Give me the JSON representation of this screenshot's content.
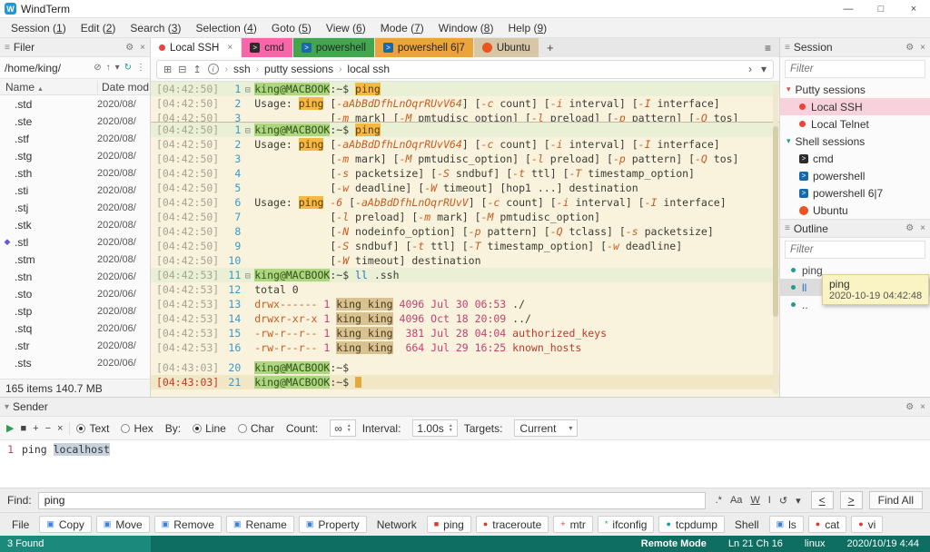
{
  "window": {
    "title": "WindTerm",
    "controls": [
      {
        "name": "minimize-button",
        "glyph": "—"
      },
      {
        "name": "maximize-button",
        "glyph": "□"
      },
      {
        "name": "close-button",
        "glyph": "×"
      }
    ]
  },
  "menu": {
    "items": [
      "Session (1)",
      "Edit (2)",
      "Search (3)",
      "Selection (4)",
      "Goto (5)",
      "View (6)",
      "Mode (7)",
      "Window (8)",
      "Help (9)"
    ]
  },
  "filer": {
    "title": "Filer",
    "path": "/home/king/",
    "path_icons": [
      {
        "name": "filter-off-icon",
        "glyph": "⊘"
      },
      {
        "name": "up-directory-icon",
        "glyph": "↑"
      },
      {
        "name": "history-icon",
        "glyph": "▾"
      },
      {
        "name": "refresh-icon",
        "glyph": "↻",
        "teal": true
      },
      {
        "name": "more-icon",
        "glyph": "⋮"
      }
    ],
    "columns": {
      "name": "Name",
      "date": "Date mod"
    },
    "rows": [
      {
        "name": ".std",
        "date": "2020/08/"
      },
      {
        "name": ".ste",
        "date": "2020/08/"
      },
      {
        "name": ".stf",
        "date": "2020/08/"
      },
      {
        "name": ".stg",
        "date": "2020/08/"
      },
      {
        "name": ".sth",
        "date": "2020/08/"
      },
      {
        "name": ".sti",
        "date": "2020/08/"
      },
      {
        "name": ".stj",
        "date": "2020/08/"
      },
      {
        "name": ".stk",
        "date": "2020/08/"
      },
      {
        "name": ".stl",
        "date": "2020/08/",
        "icon": "gem"
      },
      {
        "name": ".stm",
        "date": "2020/08/"
      },
      {
        "name": ".stn",
        "date": "2020/06/"
      },
      {
        "name": ".sto",
        "date": "2020/06/"
      },
      {
        "name": ".stp",
        "date": "2020/08/"
      },
      {
        "name": ".stq",
        "date": "2020/06/"
      },
      {
        "name": ".str",
        "date": "2020/08/"
      },
      {
        "name": ".sts",
        "date": "2020/06/"
      }
    ],
    "status": "165 items 140.7 MB"
  },
  "tabs": {
    "add_label": "+",
    "menu_icon": "≡",
    "items": [
      {
        "label": "Local SSH",
        "active": true,
        "color": "#ffffff"
      },
      {
        "label": "cmd",
        "icon": "cmd",
        "color": "#f666a8",
        "icon_color": "#2b2b2b"
      },
      {
        "label": "powershell",
        "icon": "ps",
        "color": "#42a64e",
        "icon_color": "#1769aa"
      },
      {
        "label": "powershell 6|7",
        "icon": "ps",
        "color": "#eaa43a",
        "icon_color": "#1769aa"
      },
      {
        "label": "Ubuntu",
        "icon": "ubuntu",
        "color": "#d6c7a6",
        "icon_color": "#e95420"
      }
    ]
  },
  "termbar": {
    "icons": [
      {
        "name": "new-terminal-icon",
        "glyph": "⊞"
      },
      {
        "name": "split-terminal-icon",
        "glyph": "⊟"
      },
      {
        "name": "detach-terminal-icon",
        "glyph": "↥"
      },
      {
        "name": "info-icon",
        "glyph": "i",
        "circle": true
      }
    ],
    "breadcrumb": [
      "ssh",
      "putty sessions",
      "local ssh"
    ],
    "end_icons": [
      {
        "name": "scroll-right-icon",
        "glyph": "›"
      },
      {
        "name": "sessions-dropdown-icon",
        "glyph": "▾"
      }
    ]
  },
  "terminal": {
    "top": [
      {
        "ts": "[04:42:50]",
        "num": "1",
        "fold": true,
        "bg": "cmdrow",
        "seg": [
          [
            "host",
            "king@MACBOOK"
          ],
          [
            "t",
            ":~$ "
          ],
          [
            "m",
            "ping"
          ]
        ]
      },
      {
        "ts": "[04:42:50]",
        "num": "2",
        "seg": [
          [
            "t",
            "Usage: "
          ],
          [
            "m",
            "ping"
          ],
          [
            "t",
            " ["
          ],
          [
            "f",
            "-aAbBdDfhLnOqrRUvV64"
          ],
          [
            "t",
            "] ["
          ],
          [
            "f",
            "-c"
          ],
          [
            "t",
            " count] ["
          ],
          [
            "f",
            "-i"
          ],
          [
            "t",
            " interval] ["
          ],
          [
            "f",
            "-I"
          ],
          [
            "t",
            " interface]"
          ]
        ]
      },
      {
        "ts": "[04:42:50]",
        "num": "3",
        "seg": [
          [
            "t",
            "            ["
          ],
          [
            "f",
            "-m"
          ],
          [
            "t",
            " mark] ["
          ],
          [
            "f",
            "-M"
          ],
          [
            "t",
            " pmtudisc_option] ["
          ],
          [
            "f",
            "-l"
          ],
          [
            "t",
            " preload] ["
          ],
          [
            "f",
            "-p"
          ],
          [
            "t",
            " pattern] ["
          ],
          [
            "f",
            "-Q"
          ],
          [
            "t",
            " tos]"
          ]
        ]
      }
    ],
    "lines": [
      {
        "ts": "[04:42:50]",
        "num": "1",
        "fold": true,
        "bg": "cmdrow",
        "seg": [
          [
            "host",
            "king@MACBOOK"
          ],
          [
            "t",
            ":~$ "
          ],
          [
            "m",
            "ping"
          ]
        ]
      },
      {
        "ts": "[04:42:50]",
        "num": "2",
        "seg": [
          [
            "t",
            "Usage: "
          ],
          [
            "m",
            "ping"
          ],
          [
            "t",
            " ["
          ],
          [
            "f",
            "-aAbBdDfhLnOqrRUvV64"
          ],
          [
            "t",
            "] ["
          ],
          [
            "f",
            "-c"
          ],
          [
            "t",
            " count] ["
          ],
          [
            "f",
            "-i"
          ],
          [
            "t",
            " interval] ["
          ],
          [
            "f",
            "-I"
          ],
          [
            "t",
            " interface]"
          ]
        ]
      },
      {
        "ts": "[04:42:50]",
        "num": "3",
        "seg": [
          [
            "t",
            "            ["
          ],
          [
            "f",
            "-m"
          ],
          [
            "t",
            " mark] ["
          ],
          [
            "f",
            "-M"
          ],
          [
            "t",
            " pmtudisc_option] ["
          ],
          [
            "f",
            "-l"
          ],
          [
            "t",
            " preload] ["
          ],
          [
            "f",
            "-p"
          ],
          [
            "t",
            " pattern] ["
          ],
          [
            "f",
            "-Q"
          ],
          [
            "t",
            " tos]"
          ]
        ]
      },
      {
        "ts": "[04:42:50]",
        "num": "4",
        "seg": [
          [
            "t",
            "            ["
          ],
          [
            "f",
            "-s"
          ],
          [
            "t",
            " packetsize] ["
          ],
          [
            "f",
            "-S"
          ],
          [
            "t",
            " sndbuf] ["
          ],
          [
            "f",
            "-t"
          ],
          [
            "t",
            " ttl] ["
          ],
          [
            "f",
            "-T"
          ],
          [
            "t",
            " timestamp_option]"
          ]
        ]
      },
      {
        "ts": "[04:42:50]",
        "num": "5",
        "seg": [
          [
            "t",
            "            ["
          ],
          [
            "f",
            "-w"
          ],
          [
            "t",
            " deadline] ["
          ],
          [
            "f",
            "-W"
          ],
          [
            "t",
            " timeout] [hop1 ...] destination"
          ]
        ]
      },
      {
        "ts": "[04:42:50]",
        "num": "6",
        "seg": [
          [
            "t",
            "Usage: "
          ],
          [
            "m",
            "ping"
          ],
          [
            "t",
            " "
          ],
          [
            "f",
            "-6"
          ],
          [
            "t",
            " ["
          ],
          [
            "f",
            "-aAbBdDfhLnOqrRUvV"
          ],
          [
            "t",
            "] ["
          ],
          [
            "f",
            "-c"
          ],
          [
            "t",
            " count] ["
          ],
          [
            "f",
            "-i"
          ],
          [
            "t",
            " interval] ["
          ],
          [
            "f",
            "-I"
          ],
          [
            "t",
            " interface]"
          ]
        ]
      },
      {
        "ts": "[04:42:50]",
        "num": "7",
        "seg": [
          [
            "t",
            "            ["
          ],
          [
            "f",
            "-l"
          ],
          [
            "t",
            " preload] ["
          ],
          [
            "f",
            "-m"
          ],
          [
            "t",
            " mark] ["
          ],
          [
            "f",
            "-M"
          ],
          [
            "t",
            " pmtudisc_option]"
          ]
        ]
      },
      {
        "ts": "[04:42:50]",
        "num": "8",
        "seg": [
          [
            "t",
            "            ["
          ],
          [
            "f",
            "-N"
          ],
          [
            "t",
            " nodeinfo_option] ["
          ],
          [
            "f",
            "-p"
          ],
          [
            "t",
            " pattern] ["
          ],
          [
            "f",
            "-Q"
          ],
          [
            "t",
            " tclass] ["
          ],
          [
            "f",
            "-s"
          ],
          [
            "t",
            " packetsize]"
          ]
        ]
      },
      {
        "ts": "[04:42:50]",
        "num": "9",
        "seg": [
          [
            "t",
            "            ["
          ],
          [
            "f",
            "-S"
          ],
          [
            "t",
            " sndbuf] ["
          ],
          [
            "f",
            "-t"
          ],
          [
            "t",
            " ttl] ["
          ],
          [
            "f",
            "-T"
          ],
          [
            "t",
            " timestamp_option] ["
          ],
          [
            "f",
            "-w"
          ],
          [
            "t",
            " deadline]"
          ]
        ]
      },
      {
        "ts": "[04:42:50]",
        "num": "10",
        "seg": [
          [
            "t",
            "            ["
          ],
          [
            "f",
            "-W"
          ],
          [
            "t",
            " timeout] destination"
          ]
        ]
      },
      {
        "ts": "[04:42:53]",
        "num": "11",
        "fold": true,
        "bg": "cmdrow",
        "seg": [
          [
            "host",
            "king@MACBOOK"
          ],
          [
            "t",
            ":~$ "
          ],
          [
            "blue",
            "ll"
          ],
          [
            "t",
            " .ssh"
          ]
        ]
      },
      {
        "ts": "[04:42:53]",
        "num": "12",
        "seg": [
          [
            "t",
            "total 0"
          ]
        ]
      },
      {
        "ts": "[04:42:53]",
        "num": "13",
        "seg": [
          [
            "perm",
            "drwx------"
          ],
          [
            "n",
            " 1 "
          ],
          [
            "own",
            "king king"
          ],
          [
            "n",
            " 4096 "
          ],
          [
            "date",
            "Jul 30 06:53"
          ],
          [
            "t",
            " ./"
          ]
        ]
      },
      {
        "ts": "[04:42:53]",
        "num": "14",
        "seg": [
          [
            "perm",
            "drwxr-xr-x"
          ],
          [
            "n",
            " 1 "
          ],
          [
            "own",
            "king king"
          ],
          [
            "n",
            " 4096 "
          ],
          [
            "date",
            "Oct 18 20:09"
          ],
          [
            "t",
            " ../"
          ]
        ]
      },
      {
        "ts": "[04:42:53]",
        "num": "15",
        "seg": [
          [
            "perm",
            "-rw-r--r--"
          ],
          [
            "n",
            " 1 "
          ],
          [
            "own",
            "king king"
          ],
          [
            "n",
            "  381 "
          ],
          [
            "date",
            "Jul 28 04:04"
          ],
          [
            "red",
            " authorized_keys"
          ]
        ]
      },
      {
        "ts": "[04:42:53]",
        "num": "16",
        "seg": [
          [
            "perm",
            "-rw-r--r--"
          ],
          [
            "n",
            " 1 "
          ],
          [
            "own",
            "king king"
          ],
          [
            "n",
            "  664 "
          ],
          [
            "date",
            "Jul 29 16:25"
          ],
          [
            "red",
            " known_hosts"
          ]
        ]
      },
      {
        "ts": "[04:43:03]",
        "num": "20",
        "gap": true,
        "seg": [
          [
            "host",
            "king@MACBOOK"
          ],
          [
            "t",
            ":~$"
          ]
        ]
      },
      {
        "ts": "[04:43:03]",
        "num": "21",
        "bg": "currow",
        "tsred": true,
        "cursor": true,
        "seg": [
          [
            "host",
            "king@MACBOOK"
          ],
          [
            "t",
            ":~$ "
          ]
        ]
      }
    ]
  },
  "session_panel": {
    "title": "Session",
    "filter_placeholder": "Filter",
    "groups": [
      {
        "label": "Putty sessions",
        "color": "#d14b42",
        "items": [
          {
            "label": "Local SSH",
            "icon": "dot-red",
            "selected": true
          },
          {
            "label": "Local Telnet",
            "icon": "dot-red"
          }
        ]
      },
      {
        "label": "Shell sessions",
        "color": "#1f9c8f",
        "items": [
          {
            "label": "cmd",
            "icon": "cmd"
          },
          {
            "label": "powershell",
            "icon": "ps"
          },
          {
            "label": "powershell 6|7",
            "icon": "ps"
          },
          {
            "label": "Ubuntu",
            "icon": "ubuntu"
          }
        ]
      }
    ]
  },
  "outline_panel": {
    "title": "Outline",
    "filter_placeholder": "Filter",
    "items": [
      {
        "label": "ping"
      },
      {
        "label": "ll",
        "selected": true
      },
      {
        "label": ".."
      }
    ],
    "tooltip": {
      "title": "ping",
      "time": "2020-10-19 04:42:48"
    }
  },
  "sender": {
    "title": "Sender",
    "buttons": [
      {
        "name": "send-button",
        "glyph": "▶",
        "color": "#2e9e4f"
      },
      {
        "name": "stop-button",
        "glyph": "■",
        "color": "#444444"
      },
      {
        "name": "add-line-button",
        "glyph": "+",
        "color": "#444444"
      },
      {
        "name": "remove-line-button",
        "glyph": "−",
        "color": "#444444"
      },
      {
        "name": "clear-button",
        "glyph": "×",
        "color": "#444444"
      }
    ],
    "mode": {
      "text_label": "Text",
      "hex_label": "Hex",
      "selected": "Text"
    },
    "by": {
      "label": "By:",
      "line_label": "Line",
      "char_label": "Char",
      "selected": "Line"
    },
    "count": {
      "label": "Count:",
      "value": "∞"
    },
    "interval": {
      "label": "Interval:",
      "value": "1.00s"
    },
    "targets": {
      "label": "Targets:",
      "value": "Current"
    },
    "line_number": "1",
    "command": [
      [
        "t",
        "ping "
      ],
      [
        "chip",
        "localhost"
      ]
    ]
  },
  "find": {
    "label": "Find:",
    "value": "ping",
    "icons": [
      {
        "name": "regex-icon",
        "glyph": ".*"
      },
      {
        "name": "match-case-icon",
        "glyph": "Aa"
      },
      {
        "name": "whole-word-icon",
        "glyph": "W",
        "u": true
      },
      {
        "name": "in-selection-icon",
        "glyph": "I"
      },
      {
        "name": "wrap-around-icon",
        "glyph": "↺"
      },
      {
        "name": "search-options-icon",
        "glyph": "▾"
      }
    ],
    "prev": "<",
    "next": ">",
    "find_all": "Find All"
  },
  "tools": {
    "groups": [
      {
        "label": "File",
        "buttons": [
          {
            "label": "Copy",
            "glyph": "▣",
            "color": "#3f7fd6"
          },
          {
            "label": "Move",
            "glyph": "▣",
            "color": "#3f7fd6"
          },
          {
            "label": "Remove",
            "glyph": "▣",
            "color": "#3f7fd6"
          },
          {
            "label": "Rename",
            "glyph": "▣",
            "color": "#3f7fd6"
          },
          {
            "label": "Property",
            "glyph": "▣",
            "color": "#3f7fd6"
          }
        ]
      },
      {
        "label": "Network",
        "buttons": [
          {
            "label": "ping",
            "glyph": "■",
            "color": "#d83a2e"
          },
          {
            "label": "traceroute",
            "glyph": "●",
            "color": "#d83a2e"
          },
          {
            "label": "mtr",
            "glyph": "+",
            "color": "#d83a2e"
          },
          {
            "label": "ifconfig",
            "glyph": "*",
            "color": "#18a094"
          },
          {
            "label": "tcpdump",
            "glyph": "●",
            "color": "#18a094"
          }
        ]
      },
      {
        "label": "Shell",
        "buttons": [
          {
            "label": "ls",
            "glyph": "▣",
            "color": "#3f7fd6"
          },
          {
            "label": "cat",
            "glyph": "●",
            "color": "#d83a2e"
          },
          {
            "label": "vi",
            "glyph": "●",
            "color": "#d83a2e"
          }
        ]
      }
    ]
  },
  "status_bar": {
    "found": "3 Found",
    "mode": "Remote Mode",
    "position": "Ln 21 Ch 16",
    "os": "linux",
    "time": "2020/10/19 4:44"
  },
  "colors": {
    "terminal_background": "#f9f3de",
    "prompt_highlight": "#aed581",
    "match_highlight": "#f4b942",
    "status_bar": "#0e6e62",
    "status_bar_found": "#1b8a7c",
    "tab_cmd": "#f666a8",
    "tab_powershell": "#42a64e",
    "tab_powershell67": "#eaa43a",
    "tab_ubuntu": "#d6c7a6",
    "session_selected": "#f7d2dc"
  }
}
